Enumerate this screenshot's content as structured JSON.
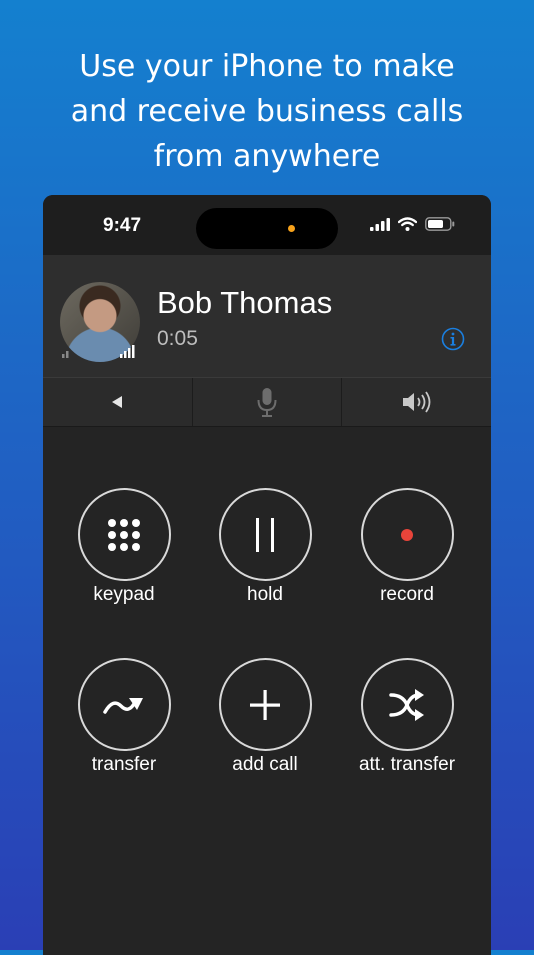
{
  "headline": {
    "line1": "Use your iPhone to make",
    "line2": "and receive business calls",
    "line3": "from anywhere"
  },
  "status_bar": {
    "time": "9:47",
    "icons": [
      "cellular-signal-icon",
      "wifi-icon",
      "battery-icon"
    ],
    "island_indicator_color": "#f7a21b"
  },
  "call": {
    "caller_name": "Bob Thomas",
    "duration": "0:05",
    "info_icon": "info-icon"
  },
  "controls": {
    "items": [
      "back-arrow-icon",
      "mute-microphone-icon",
      "speaker-icon"
    ]
  },
  "actions": [
    {
      "label": "keypad",
      "icon": "keypad-icon"
    },
    {
      "label": "hold",
      "icon": "pause-icon"
    },
    {
      "label": "record",
      "icon": "record-icon"
    },
    {
      "label": "transfer",
      "icon": "transfer-arrow-icon"
    },
    {
      "label": "add call",
      "icon": "plus-icon"
    },
    {
      "label": "att. transfer",
      "icon": "shuffle-icon"
    }
  ],
  "colors": {
    "accent_blue": "#1a7fe0",
    "record_red": "#e8443a",
    "background_top": "#1480cf",
    "background_bottom": "#2a3fb5"
  }
}
